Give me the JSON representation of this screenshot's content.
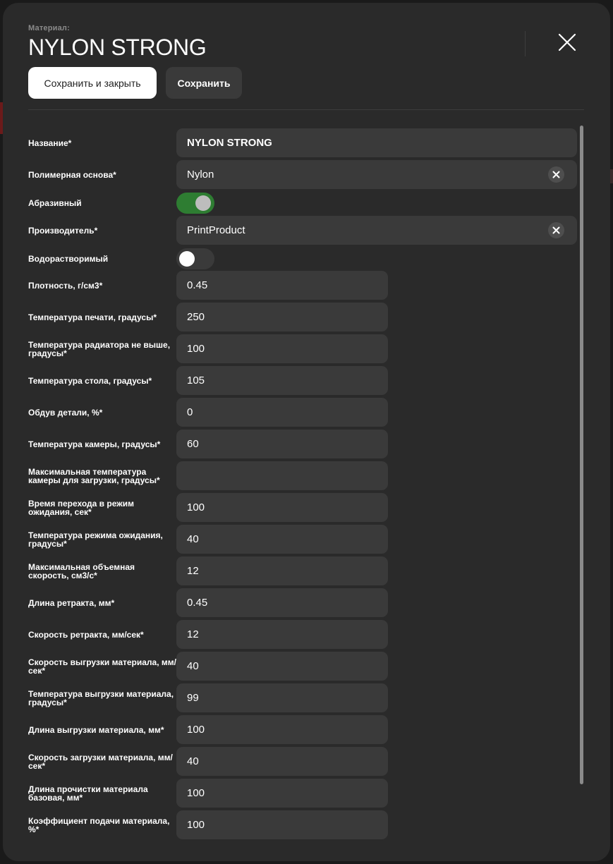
{
  "header": {
    "subtitle": "Материал:",
    "title": "NYLON STRONG"
  },
  "actions": {
    "save_close_label": "Сохранить и закрыть",
    "save_label": "Сохранить"
  },
  "fields": [
    {
      "label": "Название*",
      "value": "NYLON STRONG",
      "type": "text-wide"
    },
    {
      "label": "Полимерная основа*",
      "value": "Nylon",
      "type": "select"
    },
    {
      "label": "Абразивный",
      "type": "toggle",
      "checked": true
    },
    {
      "label": "Производитель*",
      "value": "PrintProduct",
      "type": "select"
    },
    {
      "label": "Водорастворимый",
      "type": "toggle",
      "checked": false
    },
    {
      "label": "Плотность, г/см3*",
      "value": "0.45",
      "type": "text"
    },
    {
      "label": "Температура печати, градусы*",
      "value": "250",
      "type": "text"
    },
    {
      "label": "Температура радиатора не выше, градусы*",
      "value": "100",
      "type": "text"
    },
    {
      "label": "Температура стола, градусы*",
      "value": "105",
      "type": "text"
    },
    {
      "label": "Обдув детали, %*",
      "value": "0",
      "type": "text"
    },
    {
      "label": "Температура камеры, градусы*",
      "value": "60",
      "type": "text"
    },
    {
      "label": "Максимальная температура камеры для загрузки, градусы*",
      "value": "",
      "type": "text"
    },
    {
      "label": "Время перехода в режим ожидания, сек*",
      "value": "100",
      "type": "text"
    },
    {
      "label": "Температура режима ожидания, градусы*",
      "value": "40",
      "type": "text"
    },
    {
      "label": "Максимальная объемная скорость, см3/с*",
      "value": "12",
      "type": "text"
    },
    {
      "label": "Длина ретракта, мм*",
      "value": "0.45",
      "type": "text"
    },
    {
      "label": "Скорость ретракта, мм/сек*",
      "value": "12",
      "type": "text"
    },
    {
      "label": "Скорость выгрузки материала, мм/сек*",
      "value": "40",
      "type": "text"
    },
    {
      "label": "Температура выгрузки материала, градусы*",
      "value": "99",
      "type": "text"
    },
    {
      "label": "Длина выгрузки материала, мм*",
      "value": "100",
      "type": "text"
    },
    {
      "label": "Скорость загрузки материала, мм/сек*",
      "value": "40",
      "type": "text"
    },
    {
      "label": "Длина прочистки материала базовая, мм*",
      "value": "100",
      "type": "text"
    },
    {
      "label": "Коэффициент подачи материала, %*",
      "value": "100",
      "type": "text"
    }
  ],
  "colors": {
    "modal_bg": "#2a2a2a",
    "field_bg": "#3a3a3a",
    "toggle_on": "#2e7d32",
    "primary_button": "#ffffff"
  },
  "icons": {
    "close": "close-icon",
    "clear": "clear-icon"
  }
}
